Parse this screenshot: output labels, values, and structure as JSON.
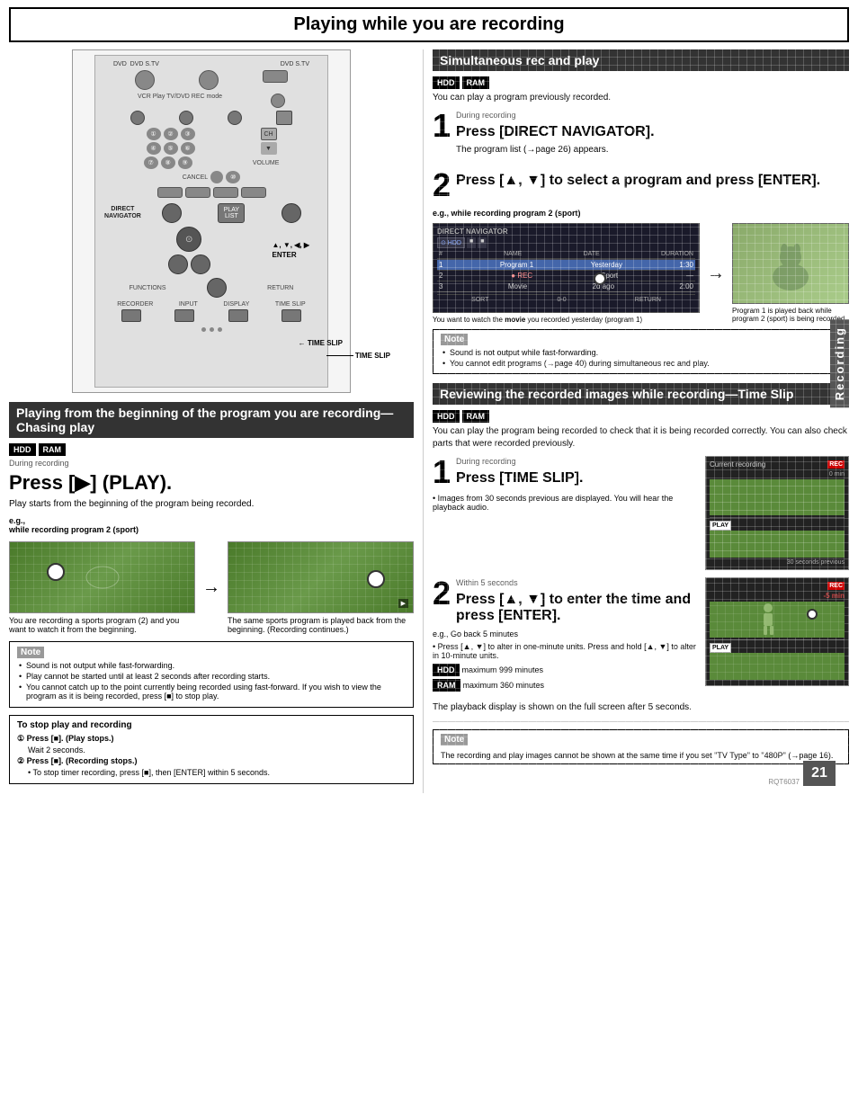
{
  "page": {
    "title": "Playing while you are recording",
    "page_number": "21",
    "footer_code": "RQT6037"
  },
  "left_col": {
    "section1": {
      "title": "Playing from the beginning of the program you are recording—Chasing play",
      "badges": [
        "HDD",
        "RAM"
      ],
      "during_label": "During recording",
      "press_action": "Press [▶] (PLAY).",
      "desc": "Play starts from the beginning of the program being recorded.",
      "eg_label": "e.g.,",
      "eg_sublabel": "while recording program 2 (sport)",
      "img1_caption": "You are recording a sports program (2) and you want to watch it from the beginning.",
      "img2_caption": "The same sports program is played back from the beginning. (Recording continues.)",
      "note": {
        "title": "Note",
        "items": [
          "Sound is not output while fast-forwarding.",
          "Play cannot be started until at least 2 seconds after recording starts.",
          "You cannot catch up to the point currently being recorded using fast-forward. If you wish to view the program as it is being recorded, press [■] to stop play."
        ]
      }
    },
    "stop_box": {
      "title": "To stop play and recording",
      "item1_num": "①",
      "item1": "Press [■]. (Play stops.)",
      "item1_sub": "Wait 2 seconds.",
      "item2_num": "②",
      "item2": "Press [■]. (Recording stops.)",
      "item2_sub": "• To stop timer recording, press [■], then [ENTER] within 5 seconds."
    }
  },
  "right_col": {
    "section1": {
      "title": "Simultaneous rec and play",
      "badges": [
        "HDD",
        "RAM"
      ],
      "intro": "You can play a program previously recorded.",
      "step1": {
        "num": "1",
        "during_label": "During recording",
        "action": "Press [DIRECT NAVIGATOR].",
        "desc": "The program list (→page 26) appears."
      },
      "step2": {
        "num": "2",
        "action": "Press [▲, ▼] to select a program and press [ENTER].",
        "eg_label": "e.g., while recording program 2 (sport)",
        "screen_caption1": "You want to watch the movie you recorded yesterday (program 1)",
        "screen_caption2": "Program 1 is played back while program 2 (sport) is being recorded."
      },
      "note": {
        "title": "Note",
        "items": [
          "Sound is not output while fast-forwarding.",
          "You cannot edit programs (→page 40) during simultaneous rec and play."
        ]
      }
    },
    "section2": {
      "title": "Reviewing the recorded images while recording—Time Slip",
      "badges": [
        "HDD",
        "RAM"
      ],
      "intro": "You can play the program being recorded to check that it is being recorded correctly. You can also check parts that were recorded previously.",
      "step1": {
        "num": "1",
        "during_label": "During recording",
        "action": "Press [TIME SLIP].",
        "sub1": "• Images from 30 seconds previous are displayed. You will hear the playback audio.",
        "display_labels": {
          "current_recording": "Current recording",
          "rec": "REC",
          "rec_time": "0 min",
          "play": "PLAY",
          "time_note": "30 seconds previous"
        }
      },
      "step2": {
        "num": "2",
        "within_label": "Within 5 seconds",
        "action": "Press [▲, ▼] to enter the time and press [ENTER].",
        "eg_note": "e.g., Go back 5 minutes",
        "sub1": "• Press [▲, ▼] to alter in one-minute units. Press and hold [▲, ▼] to alter in 10-minute units.",
        "hdd_label": "HDD:",
        "hdd_note": "maximum 999 minutes",
        "ram_label": "RAM:",
        "ram_note": "maximum 360 minutes",
        "display_labels": {
          "rec": "REC",
          "rec_time": "-5 min",
          "play": "PLAY"
        }
      },
      "footer_note": "The playback display is shown on the full screen after 5 seconds.",
      "note": {
        "title": "Note",
        "text": "The recording and play images cannot be shown at the same time if you set \"TV Type\" to \"480P\" (→page 16)."
      }
    },
    "side_label": "Recording"
  },
  "remote": {
    "direct_navigator_label": "DIRECT\nNAVIGATOR",
    "enter_label": "▲, ▼, ◀, ▶\nENTER",
    "time_slip_label": "TIME SLIP"
  }
}
